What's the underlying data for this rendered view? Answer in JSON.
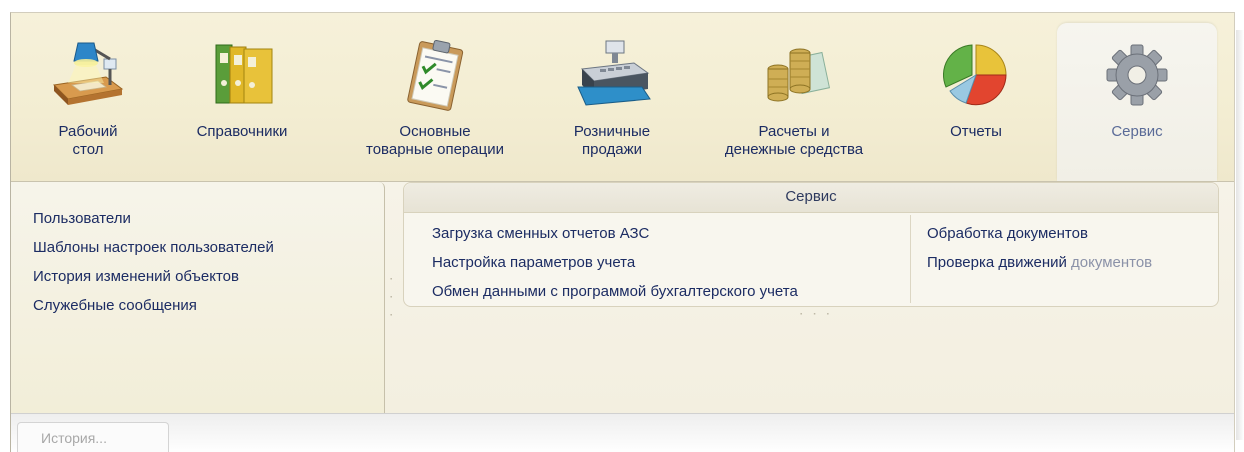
{
  "sections": [
    {
      "id": "desktop",
      "label": "Рабочий\nстол",
      "icon": "desk-lamp-icon"
    },
    {
      "id": "catalogs",
      "label": "Справочники",
      "icon": "binders-icon"
    },
    {
      "id": "operations",
      "label": "Основные\nтоварные операции",
      "icon": "clipboard-checklist-icon"
    },
    {
      "id": "retail",
      "label": "Розничные\nпродажи",
      "icon": "cash-register-icon"
    },
    {
      "id": "finance",
      "label": "Расчеты и\nденежные средства",
      "icon": "coins-icon"
    },
    {
      "id": "reports",
      "label": "Отчеты",
      "icon": "pie-chart-icon"
    },
    {
      "id": "service",
      "label": "Сервис",
      "icon": "gear-icon",
      "active": true
    }
  ],
  "left_panel": {
    "links": [
      "Пользователи",
      "Шаблоны настроек пользователей",
      "История изменений объектов",
      "Служебные сообщения"
    ]
  },
  "service_group": {
    "title": "Сервис",
    "column1": [
      "Загрузка сменных отчетов АЗС",
      "Настройка параметров учета",
      "Обмен данными с программой бухгалтерского учета"
    ],
    "column2": [
      "Обработка документов",
      {
        "main": "Проверка движений ",
        "faded": "документов"
      }
    ]
  },
  "bottom_bar": {
    "history_label": "История..."
  },
  "colors": {
    "link": "#1c2c63",
    "active_label": "#5a6b97",
    "panel_bg": "#f7f3e4"
  }
}
